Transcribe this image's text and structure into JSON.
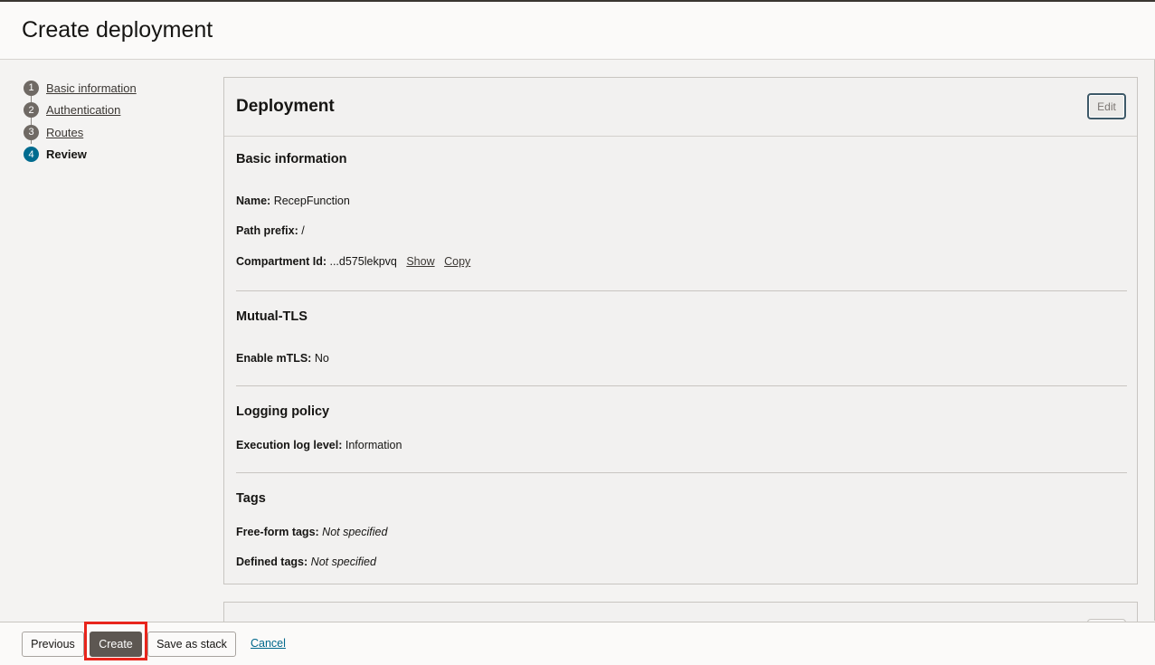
{
  "page": {
    "title": "Create deployment"
  },
  "steps": [
    {
      "num": "1",
      "label": "Basic information"
    },
    {
      "num": "2",
      "label": "Authentication"
    },
    {
      "num": "3",
      "label": "Routes"
    },
    {
      "num": "4",
      "label": "Review"
    }
  ],
  "card": {
    "title": "Deployment",
    "edit_label": "Edit",
    "basic": {
      "heading": "Basic information",
      "name_label": "Name:",
      "name_value": "RecepFunction",
      "path_label": "Path prefix:",
      "path_value": "/",
      "compartment_label": "Compartment Id:",
      "compartment_value": "...d575lekpvq",
      "show_label": "Show",
      "copy_label": "Copy"
    },
    "mtls": {
      "heading": "Mutual-TLS",
      "enable_label": "Enable mTLS:",
      "enable_value": "No"
    },
    "logging": {
      "heading": "Logging policy",
      "level_label": "Execution log level:",
      "level_value": "Information"
    },
    "tags": {
      "heading": "Tags",
      "freeform_label": "Free-form tags:",
      "freeform_value": "Not specified",
      "defined_label": "Defined tags:",
      "defined_value": "Not specified"
    }
  },
  "footer": {
    "previous_label": "Previous",
    "create_label": "Create",
    "stack_label": "Save as stack",
    "cancel_label": "Cancel"
  },
  "colors": {
    "active_step": "#006b8f",
    "primary_button": "#5d5752",
    "highlight": "#e8251c",
    "link": "#00688c"
  }
}
